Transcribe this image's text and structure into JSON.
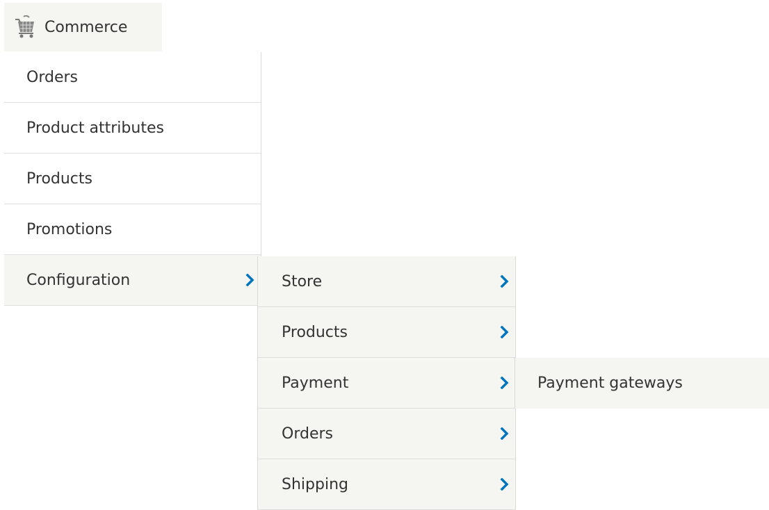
{
  "toolbar": {
    "tab_label": "Commerce",
    "tab_icon": "shopping-cart-icon"
  },
  "menu": {
    "level1": [
      {
        "label": "Orders"
      },
      {
        "label": "Product attributes"
      },
      {
        "label": "Products"
      },
      {
        "label": "Promotions"
      },
      {
        "label": "Configuration",
        "has_children": true,
        "expanded": true
      }
    ],
    "level2": [
      {
        "label": "Store",
        "has_children": true
      },
      {
        "label": "Products",
        "has_children": true
      },
      {
        "label": "Payment",
        "has_children": true,
        "expanded": true
      },
      {
        "label": "Orders",
        "has_children": true
      },
      {
        "label": "Shipping",
        "has_children": true
      }
    ],
    "level3": [
      {
        "label": "Payment gateways"
      }
    ]
  },
  "colors": {
    "chevron": "#0074bd",
    "menu_bg": "#f5f5f2",
    "text": "#333333"
  }
}
